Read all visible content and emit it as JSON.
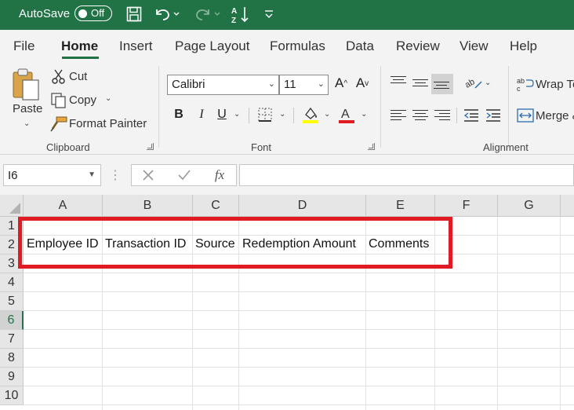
{
  "titlebar": {
    "autosave_label": "AutoSave",
    "autosave_state": "Off",
    "icons": [
      "save-icon",
      "undo-icon",
      "redo-icon",
      "sort-icon",
      "customize-toolbar-icon"
    ]
  },
  "tabs": [
    "File",
    "Home",
    "Insert",
    "Page Layout",
    "Formulas",
    "Data",
    "Review",
    "View",
    "Help"
  ],
  "active_tab": "Home",
  "ribbon": {
    "clipboard": {
      "paste_label": "Paste",
      "cut_label": "Cut",
      "copy_label": "Copy",
      "format_painter_label": "Format Painter",
      "group_label": "Clipboard"
    },
    "font": {
      "font_name": "Calibri",
      "font_size": "11",
      "bold": "B",
      "italic": "I",
      "underline": "U",
      "group_label": "Font",
      "highlight_color": "#ffff00",
      "font_color": "#e01b24"
    },
    "alignment": {
      "wrap_text_label": "Wrap Te",
      "merge_label": "Merge &",
      "group_label": "Alignment"
    }
  },
  "formula_bar": {
    "name_box": "I6",
    "fx_label": "fx",
    "formula_value": ""
  },
  "grid": {
    "columns": [
      "A",
      "B",
      "C",
      "D",
      "E",
      "F",
      "G"
    ],
    "rows": [
      "1",
      "2",
      "3",
      "4",
      "5",
      "6",
      "7",
      "8",
      "9",
      "10"
    ],
    "active_row": "6",
    "headers_row_cells": [
      "Employee ID",
      "Transaction ID",
      "Source",
      "Redemption Amount",
      "Comments"
    ],
    "highlight_color": "#e01b24"
  },
  "colors": {
    "brand": "#217346",
    "ribbon_bg": "#f3f3f3"
  }
}
